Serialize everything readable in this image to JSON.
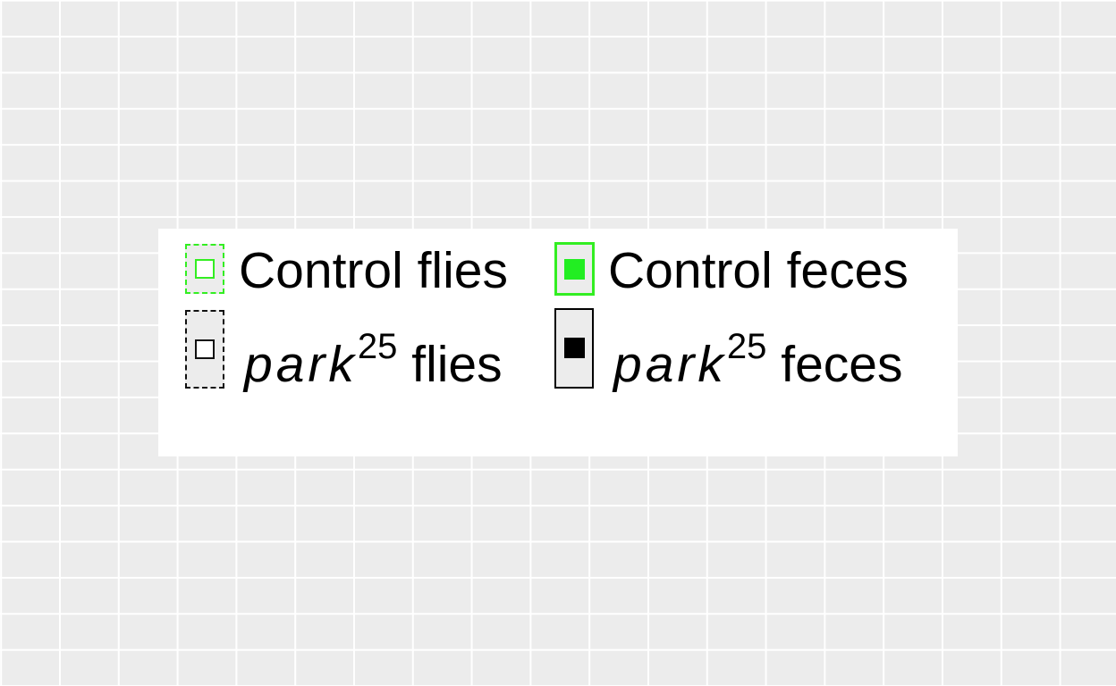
{
  "chart_data": {
    "type": "bar",
    "legend": {
      "entries": [
        {
          "id": "control-flies",
          "label": "Control flies",
          "border_color": "#33ee22",
          "border_style": "dashed",
          "fill_color": "#ffffff"
        },
        {
          "id": "control-feces",
          "label": "Control feces",
          "border_color": "#33ee22",
          "border_style": "solid",
          "fill_color": "#22ee22"
        },
        {
          "id": "park-flies",
          "gene": "park",
          "allele": "25",
          "suffix": " flies",
          "border_color": "#000000",
          "border_style": "dashed",
          "fill_color": "#ffffff"
        },
        {
          "id": "park-feces",
          "gene": "park",
          "allele": "25",
          "suffix": " feces",
          "border_color": "#000000",
          "border_style": "solid",
          "fill_color": "#000000"
        }
      ]
    },
    "panel_background": "#ececec",
    "grid": true
  }
}
